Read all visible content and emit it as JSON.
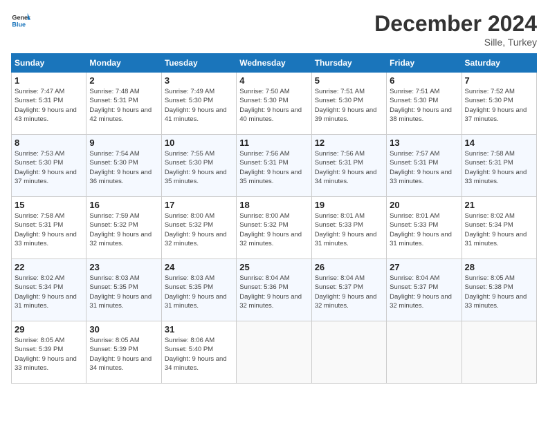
{
  "header": {
    "logo_text_general": "General",
    "logo_text_blue": "Blue",
    "month_title": "December 2024",
    "location": "Sille, Turkey"
  },
  "days_of_week": [
    "Sunday",
    "Monday",
    "Tuesday",
    "Wednesday",
    "Thursday",
    "Friday",
    "Saturday"
  ],
  "weeks": [
    [
      {
        "num": "1",
        "sunrise": "7:47 AM",
        "sunset": "5:31 PM",
        "daylight": "9 hours and 43 minutes."
      },
      {
        "num": "2",
        "sunrise": "7:48 AM",
        "sunset": "5:31 PM",
        "daylight": "9 hours and 42 minutes."
      },
      {
        "num": "3",
        "sunrise": "7:49 AM",
        "sunset": "5:30 PM",
        "daylight": "9 hours and 41 minutes."
      },
      {
        "num": "4",
        "sunrise": "7:50 AM",
        "sunset": "5:30 PM",
        "daylight": "9 hours and 40 minutes."
      },
      {
        "num": "5",
        "sunrise": "7:51 AM",
        "sunset": "5:30 PM",
        "daylight": "9 hours and 39 minutes."
      },
      {
        "num": "6",
        "sunrise": "7:51 AM",
        "sunset": "5:30 PM",
        "daylight": "9 hours and 38 minutes."
      },
      {
        "num": "7",
        "sunrise": "7:52 AM",
        "sunset": "5:30 PM",
        "daylight": "9 hours and 37 minutes."
      }
    ],
    [
      {
        "num": "8",
        "sunrise": "7:53 AM",
        "sunset": "5:30 PM",
        "daylight": "9 hours and 37 minutes."
      },
      {
        "num": "9",
        "sunrise": "7:54 AM",
        "sunset": "5:30 PM",
        "daylight": "9 hours and 36 minutes."
      },
      {
        "num": "10",
        "sunrise": "7:55 AM",
        "sunset": "5:30 PM",
        "daylight": "9 hours and 35 minutes."
      },
      {
        "num": "11",
        "sunrise": "7:56 AM",
        "sunset": "5:31 PM",
        "daylight": "9 hours and 35 minutes."
      },
      {
        "num": "12",
        "sunrise": "7:56 AM",
        "sunset": "5:31 PM",
        "daylight": "9 hours and 34 minutes."
      },
      {
        "num": "13",
        "sunrise": "7:57 AM",
        "sunset": "5:31 PM",
        "daylight": "9 hours and 33 minutes."
      },
      {
        "num": "14",
        "sunrise": "7:58 AM",
        "sunset": "5:31 PM",
        "daylight": "9 hours and 33 minutes."
      }
    ],
    [
      {
        "num": "15",
        "sunrise": "7:58 AM",
        "sunset": "5:31 PM",
        "daylight": "9 hours and 33 minutes."
      },
      {
        "num": "16",
        "sunrise": "7:59 AM",
        "sunset": "5:32 PM",
        "daylight": "9 hours and 32 minutes."
      },
      {
        "num": "17",
        "sunrise": "8:00 AM",
        "sunset": "5:32 PM",
        "daylight": "9 hours and 32 minutes."
      },
      {
        "num": "18",
        "sunrise": "8:00 AM",
        "sunset": "5:32 PM",
        "daylight": "9 hours and 32 minutes."
      },
      {
        "num": "19",
        "sunrise": "8:01 AM",
        "sunset": "5:33 PM",
        "daylight": "9 hours and 31 minutes."
      },
      {
        "num": "20",
        "sunrise": "8:01 AM",
        "sunset": "5:33 PM",
        "daylight": "9 hours and 31 minutes."
      },
      {
        "num": "21",
        "sunrise": "8:02 AM",
        "sunset": "5:34 PM",
        "daylight": "9 hours and 31 minutes."
      }
    ],
    [
      {
        "num": "22",
        "sunrise": "8:02 AM",
        "sunset": "5:34 PM",
        "daylight": "9 hours and 31 minutes."
      },
      {
        "num": "23",
        "sunrise": "8:03 AM",
        "sunset": "5:35 PM",
        "daylight": "9 hours and 31 minutes."
      },
      {
        "num": "24",
        "sunrise": "8:03 AM",
        "sunset": "5:35 PM",
        "daylight": "9 hours and 31 minutes."
      },
      {
        "num": "25",
        "sunrise": "8:04 AM",
        "sunset": "5:36 PM",
        "daylight": "9 hours and 32 minutes."
      },
      {
        "num": "26",
        "sunrise": "8:04 AM",
        "sunset": "5:37 PM",
        "daylight": "9 hours and 32 minutes."
      },
      {
        "num": "27",
        "sunrise": "8:04 AM",
        "sunset": "5:37 PM",
        "daylight": "9 hours and 32 minutes."
      },
      {
        "num": "28",
        "sunrise": "8:05 AM",
        "sunset": "5:38 PM",
        "daylight": "9 hours and 33 minutes."
      }
    ],
    [
      {
        "num": "29",
        "sunrise": "8:05 AM",
        "sunset": "5:39 PM",
        "daylight": "9 hours and 33 minutes."
      },
      {
        "num": "30",
        "sunrise": "8:05 AM",
        "sunset": "5:39 PM",
        "daylight": "9 hours and 34 minutes."
      },
      {
        "num": "31",
        "sunrise": "8:06 AM",
        "sunset": "5:40 PM",
        "daylight": "9 hours and 34 minutes."
      },
      null,
      null,
      null,
      null
    ]
  ]
}
